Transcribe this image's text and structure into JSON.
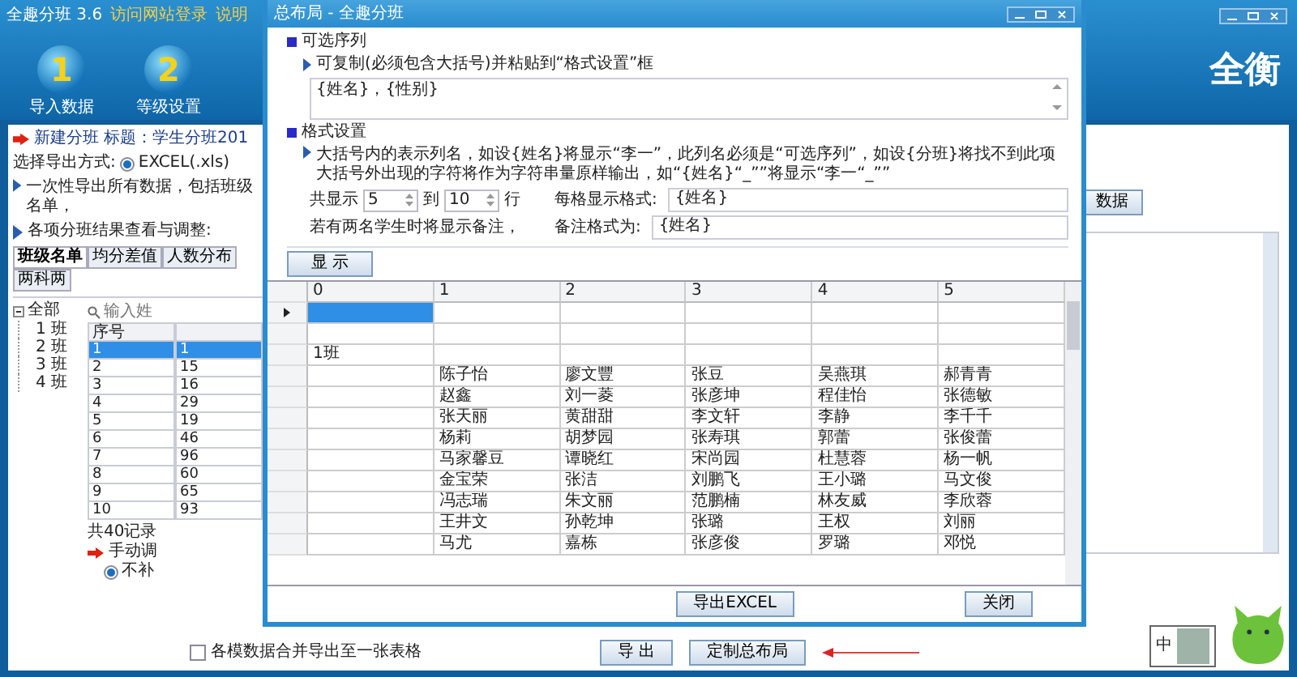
{
  "app": {
    "title": "全趣分班 3.6",
    "links": [
      "访问网站登录",
      "说明"
    ],
    "logo": "全衡",
    "toolbar": [
      {
        "badge": "1",
        "label": "导入数据"
      },
      {
        "badge": "2",
        "label": "等级设置"
      }
    ]
  },
  "panel": {
    "heading": "新建分班",
    "title": "标题：学生分班201",
    "export_label": "选择导出方式:",
    "export_options": [
      {
        "label": "EXCEL(.xls)",
        "selected": true
      }
    ],
    "note": "一次性导出所有数据，包括班级名单，",
    "results_label": "各项分班结果查看与调整:",
    "tabs": [
      {
        "label": "班级名单",
        "selected": true
      },
      {
        "label": "均分差值",
        "selected": false
      },
      {
        "label": "人数分布",
        "selected": false
      },
      {
        "label": "两科两",
        "selected": false
      }
    ],
    "tree": [
      {
        "label": "全部",
        "expanded": true,
        "children": [
          {
            "label": "1 班"
          },
          {
            "label": "2 班"
          },
          {
            "label": "3 班"
          },
          {
            "label": "4 班"
          }
        ]
      }
    ],
    "search": {
      "placeholder": "输入姓"
    },
    "table": {
      "columns": [
        "序号"
      ],
      "rows": [
        {
          "no": "1",
          "value": "1",
          "selected": true
        },
        {
          "no": "2",
          "value": "15",
          "selected": false
        },
        {
          "no": "3",
          "value": "16",
          "selected": false
        },
        {
          "no": "4",
          "value": "29",
          "selected": false
        },
        {
          "no": "5",
          "value": "19",
          "selected": false
        },
        {
          "no": "6",
          "value": "46",
          "selected": false
        },
        {
          "no": "7",
          "value": "96",
          "selected": false
        },
        {
          "no": "8",
          "value": "60",
          "selected": false
        },
        {
          "no": "9",
          "value": "65",
          "selected": false
        },
        {
          "no": "10",
          "value": "93",
          "selected": false
        }
      ]
    },
    "count": "共40记录",
    "manual": "手动调",
    "options": [
      {
        "label": "不补",
        "selected": true
      }
    ],
    "right_button": "数据"
  },
  "bottom": {
    "merge": {
      "label": "各模数据合并导出至一张表格",
      "checked": false
    },
    "buttons": [
      "导 出",
      "定制总布局"
    ]
  },
  "dialog": {
    "title": "总布局 - 全趣分班",
    "available": {
      "heading": "可选序列",
      "hint": "可复制(必须包含大括号)并粘贴到“格式设置”框",
      "value": "{姓名}，{性别}"
    },
    "format": {
      "heading": "格式设置",
      "notes": [
        "大括号内的表示列名，如设{姓名}将显示“李一”，此列名必须是“可选序列”，如设{分班}将找不到此项",
        "大括号外出现的字符将作为字符串量原样输出，如“{姓名}“_””将显示“李一“_””"
      ],
      "range_label": "共显示",
      "from": "5",
      "to_label": "到",
      "to": "10",
      "rows_label": "行",
      "cell_format_label": "每格显示格式:",
      "cell_format": "{姓名}",
      "remark_note": "若有两名学生时将显示备注，",
      "remark_label": "备注格式为:",
      "remark_format": "{姓名}"
    },
    "show_button": "显 示",
    "grid": {
      "columns": [
        "0",
        "1",
        "2",
        "3",
        "4",
        "5"
      ],
      "rows": [
        {
          "kind": "blank",
          "selected": true
        },
        {
          "kind": "blank",
          "selected": false
        },
        {
          "kind": "group",
          "label": "1班",
          "selected": false
        },
        {
          "kind": "names",
          "names": [
            "陈子怡",
            "廖文豐",
            "张豆",
            "吴燕琪",
            "郝青青"
          ],
          "selected": false
        },
        {
          "kind": "names",
          "names": [
            "赵鑫",
            "刘一菱",
            "张彦坤",
            "程佳怡",
            "张德敏"
          ],
          "selected": false
        },
        {
          "kind": "names",
          "names": [
            "张天丽",
            "黄甜甜",
            "李文轩",
            "李静",
            "李千千"
          ],
          "selected": false
        },
        {
          "kind": "names",
          "names": [
            "杨莉",
            "胡梦园",
            "张寿琪",
            "郭蕾",
            "张俊蕾"
          ],
          "selected": false
        },
        {
          "kind": "names",
          "names": [
            "马家馨豆",
            "谭晓红",
            "宋尚园",
            "杜慧蓉",
            "杨一帆"
          ],
          "selected": false
        },
        {
          "kind": "names",
          "names": [
            "金宝荣",
            "张洁",
            "刘鹏飞",
            "王小璐",
            "马文俊"
          ],
          "selected": false
        },
        {
          "kind": "names",
          "names": [
            "冯志瑞",
            "朱文丽",
            "范鹏楠",
            "林友威",
            "李欣蓉"
          ],
          "selected": false
        },
        {
          "kind": "names",
          "names": [
            "王井文",
            "孙乾坤",
            "张璐",
            "王权",
            "刘丽"
          ],
          "selected": false
        },
        {
          "kind": "names",
          "names": [
            "马尤",
            "嘉栋",
            "张彦俊",
            "罗璐",
            "邓悦"
          ],
          "selected": false
        }
      ]
    },
    "buttons": [
      "导出EXCEL",
      "关闭"
    ]
  },
  "tray": {
    "ime": "中"
  }
}
